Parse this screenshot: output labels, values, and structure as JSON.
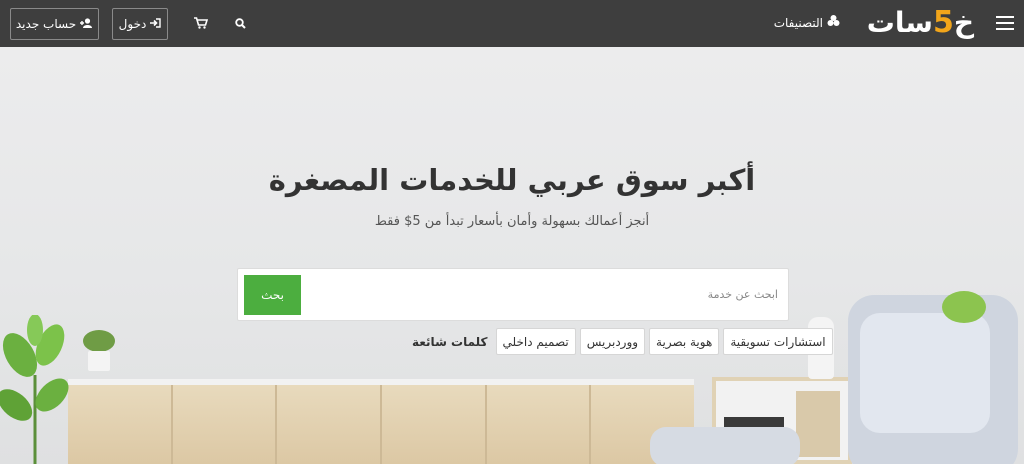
{
  "nav": {
    "logo_part1": "خ",
    "logo_five": "5",
    "logo_part2": "سات",
    "categories_label": "التصنيفات",
    "login_label": "دخول",
    "register_label": "حساب جديد"
  },
  "hero": {
    "headline": "أكبر سوق عربي للخدمات المصغرة",
    "subline": "أنجز أعمالك بسهولة وأمان بأسعار تبدأ من 5$ فقط"
  },
  "search": {
    "placeholder": "ابحث عن خدمة",
    "button_label": "بحث"
  },
  "popular": {
    "label": "كلمات شائعة",
    "tags": [
      "تصميم داخلي",
      "ووردبريس",
      "هوية بصرية",
      "استشارات تسويقية"
    ]
  },
  "colors": {
    "topbar": "#3e3e3e",
    "accent_orange": "#f2a51a",
    "search_button": "#4cae3f"
  }
}
